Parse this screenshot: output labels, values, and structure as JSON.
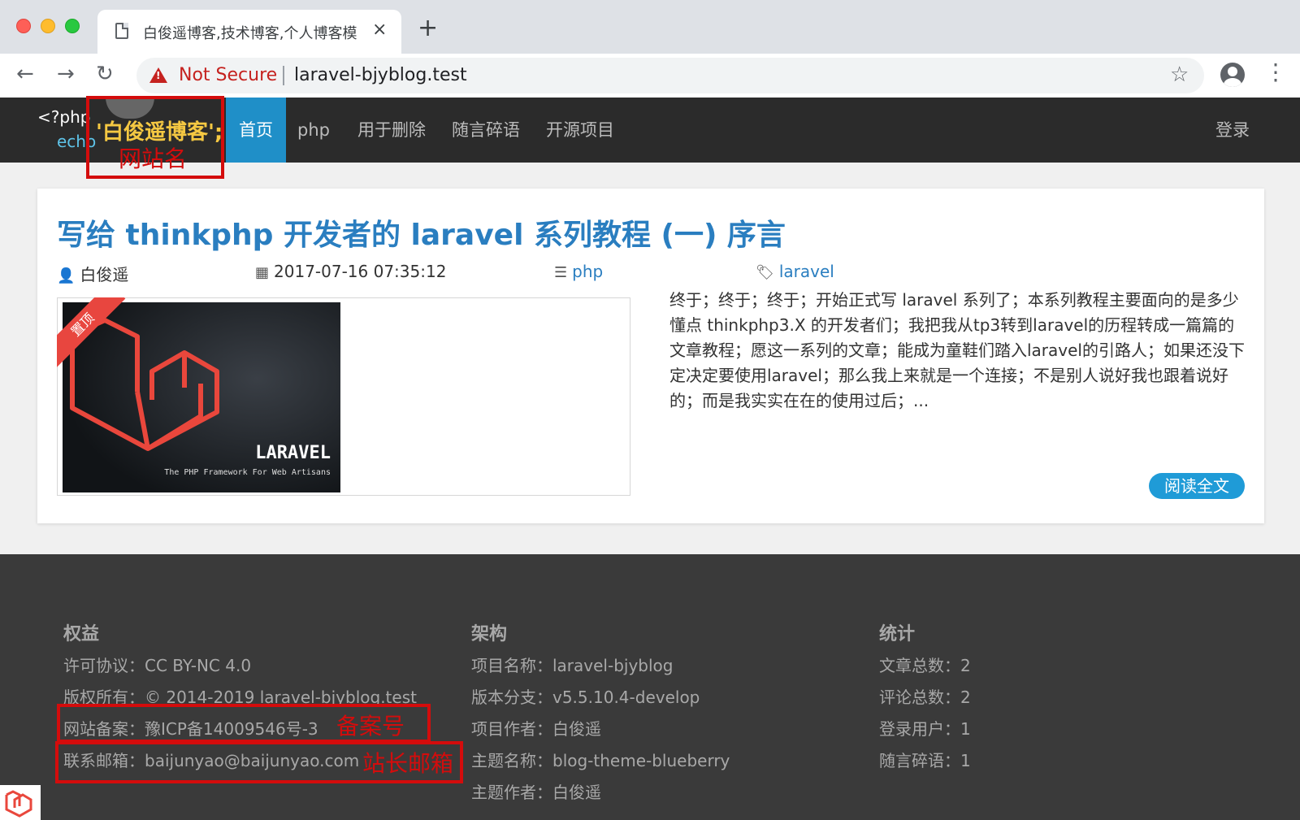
{
  "browser": {
    "tab_title": "白俊遥博客,技术博客,个人博客模",
    "tab_close": "×",
    "new_tab": "+",
    "not_secure": "Not Secure",
    "url": "laravel-bjyblog.test",
    "icons": [
      "back-icon",
      "forward-icon",
      "reload-icon",
      "warning-icon",
      "star-icon",
      "profile-icon",
      "menu-icon",
      "document-icon"
    ]
  },
  "site": {
    "logo_php": "<?php",
    "logo_echo": "echo",
    "logo_name": "'白俊遥博客';",
    "nav": [
      "首页",
      "php",
      "用于删除",
      "随言碎语",
      "开源项目"
    ],
    "login": "登录"
  },
  "post": {
    "title": "写给 thinkphp 开发者的 laravel 系列教程 (一) 序言",
    "author": "白俊遥",
    "date": "2017-07-16 07:35:12",
    "category": "php",
    "tag": "laravel",
    "ribbon": "置顶",
    "thumb_brand": "LARAVEL",
    "thumb_tagline": "The PHP Framework For Web Artisans",
    "excerpt": "终于；终于；终于；开始正式写 laravel 系列了；本系列教程主要面向的是多少懂点 thinkphp3.X 的开发者们；我把我从tp3转到laravel的历程转成一篇篇的文章教程；愿这一系列的文章；能成为童鞋们踏入laravel的引路人；如果还没下定决定要使用laravel；那么我上来就是一个连接；不是别人说好我也跟着说好的；而是我实实在在的使用过后；...",
    "read_more": "阅读全文"
  },
  "footer": {
    "columns": [
      {
        "heading": "权益",
        "rows": [
          "许可协议：CC BY-NC 4.0",
          "版权所有：© 2014-2019 laravel-bjyblog.test",
          "网站备案：豫ICP备14009546号-3",
          "联系邮箱：baijunyao@baijunyao.com"
        ]
      },
      {
        "heading": "架构",
        "rows": [
          "项目名称：laravel-bjyblog",
          "版本分支：v5.5.10.4-develop",
          "项目作者：白俊遥",
          "主题名称：blog-theme-blueberry",
          "主题作者：白俊遥"
        ]
      },
      {
        "heading": "统计",
        "rows": [
          "文章总数：2",
          "评论总数：2",
          "登录用户：1",
          "随言碎语：1"
        ]
      }
    ]
  },
  "annotations": {
    "site_name": "网站名",
    "icp": "备案号",
    "email": "站长邮箱"
  },
  "colors": {
    "navbar": "#2b2b2b",
    "nav_active": "#1f8fc8",
    "link": "#2a7ec0",
    "footer": "#3a3a3a",
    "annotation": "#d40c0c"
  }
}
